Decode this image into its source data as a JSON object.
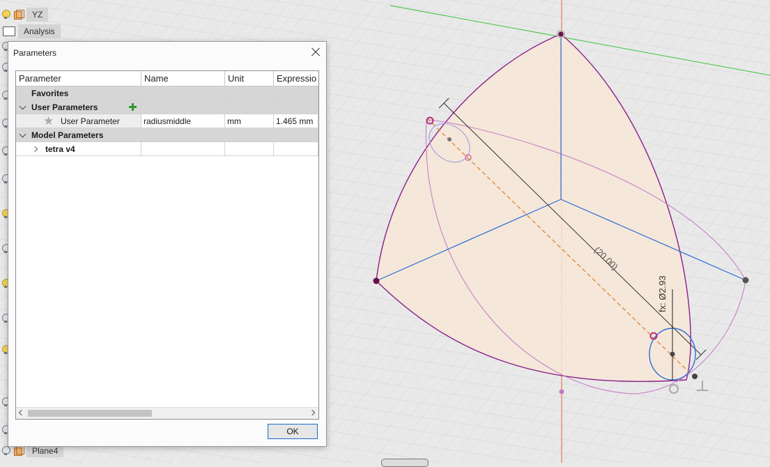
{
  "browser": {
    "items": [
      {
        "label": "YZ",
        "icon": "plane-icon"
      },
      {
        "label": "Analysis",
        "icon": "folder-icon"
      },
      {
        "label": "Plane4",
        "icon": "plane-icon"
      }
    ]
  },
  "dialog": {
    "title": "Parameters",
    "columns": [
      "Parameter",
      "Name",
      "Unit",
      "Expressio"
    ],
    "groups": {
      "favorites": "Favorites",
      "user_parameters": "User Parameters",
      "model_parameters": "Model Parameters"
    },
    "user_parameter_row": {
      "parameter": "User Parameter",
      "name": "radiusmiddle",
      "unit": "mm",
      "expression": "1.465 mm"
    },
    "model_row": {
      "parameter": "tetra v4"
    },
    "ok_label": "OK"
  },
  "viewport": {
    "dimension_linear": "(20.00)",
    "dimension_diameter": "fx: Ø2.93",
    "colors": {
      "face_fill": "#f7e6d6",
      "outline": "#8a1f8a",
      "axis_blue": "#2a6fd6",
      "axis_red": "#e0653c",
      "axis_green": "#3cc23c",
      "dashed": "#e08a3c"
    }
  }
}
